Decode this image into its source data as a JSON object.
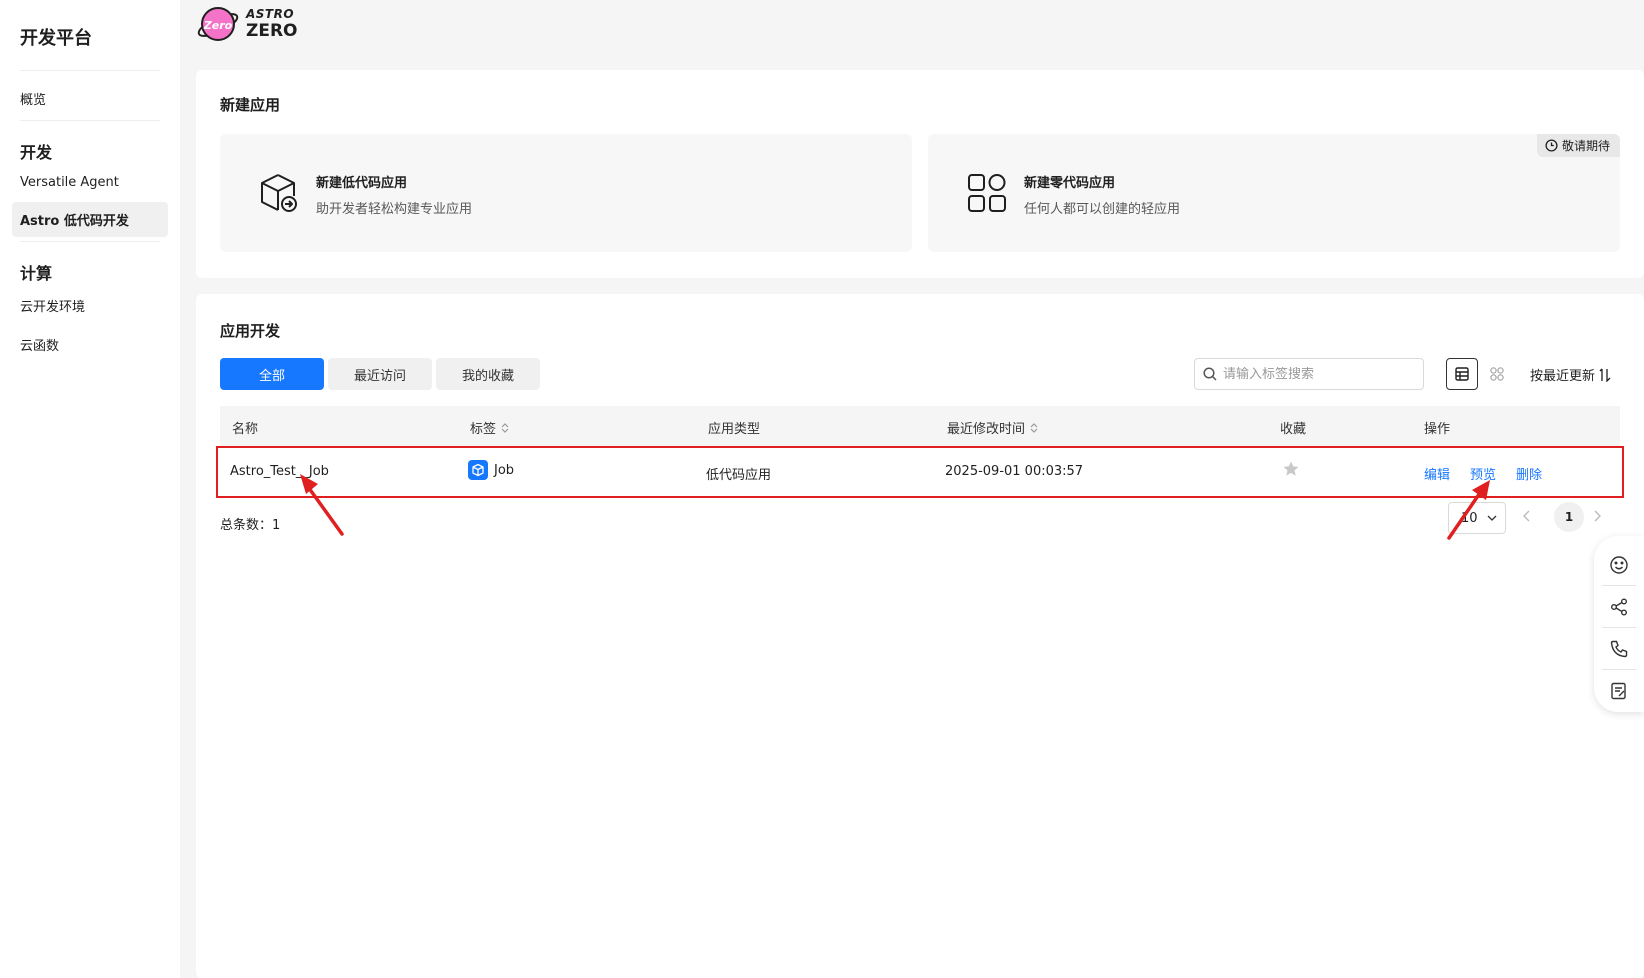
{
  "sidebar": {
    "title": "开发平台",
    "overview": "概览",
    "group_dev": "开发",
    "versatile_agent": "Versatile Agent",
    "astro_lowcode": "Astro 低代码开发",
    "group_compute": "计算",
    "cloud_env": "云开发环境",
    "cloud_func": "云函数"
  },
  "logo": {
    "badge": "Zero",
    "line1": "ASTRO",
    "line2": "ZERO"
  },
  "new_app": {
    "title": "新建应用",
    "lowcode_name": "新建低代码应用",
    "lowcode_desc": "助开发者轻松构建专业应用",
    "zerocode_name": "新建零代码应用",
    "zerocode_desc": "任何人都可以创建的轻应用",
    "coming_soon": "敬请期待"
  },
  "app_dev": {
    "title": "应用开发",
    "tabs": [
      "全部",
      "最近访问",
      "我的收藏"
    ],
    "search_placeholder": "请输入标签搜索",
    "sort_label": "按最近更新"
  },
  "table": {
    "headers": {
      "name": "名称",
      "tag": "标签",
      "type": "应用类型",
      "modified": "最近修改时间",
      "favorite": "收藏",
      "actions": "操作"
    },
    "rows": [
      {
        "name": "Astro_Test__Job",
        "tag": "Job",
        "type": "低代码应用",
        "modified": "2025-09-01 00:03:57",
        "edit": "编辑",
        "preview": "预览",
        "delete": "删除"
      }
    ]
  },
  "pagination": {
    "total_label": "总条数：",
    "total": "1",
    "page_size": "10",
    "current_page": "1"
  },
  "colors": {
    "primary": "#1677ff",
    "annotation": "#e02020"
  }
}
